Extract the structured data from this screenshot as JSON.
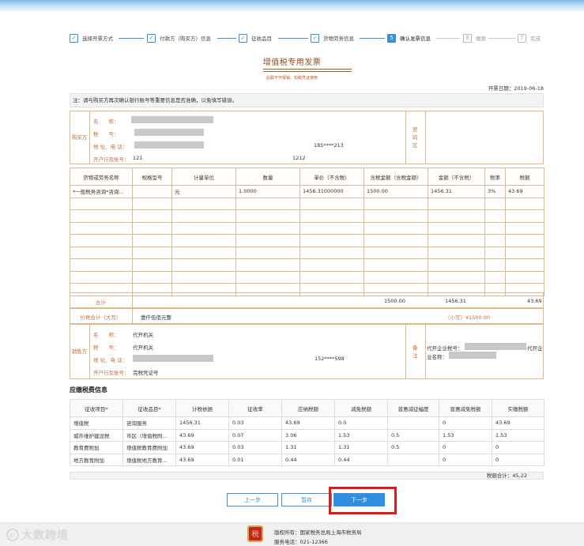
{
  "steps": [
    {
      "num": "✓",
      "label": "选择开票方式",
      "state": "done"
    },
    {
      "num": "✓",
      "label": "付款方（购买方）信息",
      "state": "done"
    },
    {
      "num": "✓",
      "label": "征收品目",
      "state": "done"
    },
    {
      "num": "✓",
      "label": "货物劳务信息",
      "state": "done"
    },
    {
      "num": "5",
      "label": "确认发票信息",
      "state": "current"
    },
    {
      "num": "6",
      "label": "缴款",
      "state": "future"
    },
    {
      "num": "7",
      "label": "完成",
      "state": "future"
    }
  ],
  "invoice": {
    "title": "增值税专用发票",
    "subtitle": "此联不作报销、扣税凭证使用",
    "date_label": "开票日期：2019-06-18",
    "note": "注：请与购买方再次确认银行账号等重要信息是否准确，以免填写错误。",
    "buyer": {
      "side_label": "购买方",
      "name_label": "名　　称：",
      "tax_label": "税　　号：",
      "addr_label": "地 址、电 话：",
      "addr_phone": "185****213",
      "bank_label": "开户行及账号：",
      "bank_value": "121",
      "account_value": "1212",
      "pwd_label": "密码区"
    },
    "items_header": [
      "货物或劳务名称",
      "规格型号",
      "计量单位",
      "数量",
      "单价（不含税）",
      "含税金额（含税金额）",
      "金额（不含税）",
      "税率",
      "税额"
    ],
    "items": [
      [
        "*一般税务咨询*咨询...",
        "",
        "元",
        "1.0000",
        "1456.31000000",
        "1500.00",
        "1456.31",
        "3%",
        "43.69"
      ]
    ],
    "totals": {
      "label": "合计",
      "tax_incl": "1500.00",
      "amount": "1456.31",
      "tax": "43.69"
    },
    "grand": {
      "label": "价税合计（大写）",
      "upper": "壹仟伍佰元整",
      "lower": "（小写）¥1500.00"
    },
    "seller": {
      "side_label": "销售方",
      "name_label": "名　　称：",
      "name_value": "代开机关",
      "tax_label": "税　　号：",
      "tax_value": "代开机关",
      "addr_label": "地 址、电 话：",
      "addr_phone": "152****598",
      "bank_label": "开户行及账号：",
      "bank_value": "完税凭证号",
      "remark_label": "备注",
      "remark_line1": "代开企业税号：",
      "remark_line1b": "代开企",
      "remark_line2": "业名称："
    }
  },
  "tax_section": {
    "title": "应缴税费信息",
    "headers": [
      "征收项目*",
      "征收品目*",
      "计税依据",
      "征收率",
      "应纳税额",
      "减免税额",
      "普惠减征幅度",
      "普惠减免税额",
      "实缴税额"
    ],
    "rows": [
      [
        "增值税",
        "咨询服务",
        "1456.31",
        "0.03",
        "43.69",
        "0.0",
        "",
        "0",
        "43.69"
      ],
      [
        "城市维护建设税",
        "市区（增值税附...",
        "43.69",
        "0.07",
        "3.06",
        "1.53",
        "0.5",
        "1.53",
        "1.53"
      ],
      [
        "教育费附加",
        "增值税教育费附加",
        "43.69",
        "0.03",
        "1.31",
        "1.31",
        "0.5",
        "0",
        "0"
      ],
      [
        "地方教育附加",
        "增值税地方教育...",
        "43.69",
        "0.01",
        "0.44",
        "0.44",
        "",
        "0",
        "0"
      ]
    ],
    "total": "税额合计：45.22"
  },
  "buttons": {
    "prev": "上一步",
    "save": "暂存",
    "next": "下一步"
  },
  "footer": {
    "line1": "版权所有：国家税务总局上海市税务局",
    "line2": "服务电话：021-12366",
    "watermark": "大数跨境",
    "emblem": "税"
  },
  "colors": {
    "accent": "#3a8fd6",
    "invoice_border": "#e0b88e",
    "invoice_label": "#c07040",
    "highlight": "#e11a1a"
  }
}
